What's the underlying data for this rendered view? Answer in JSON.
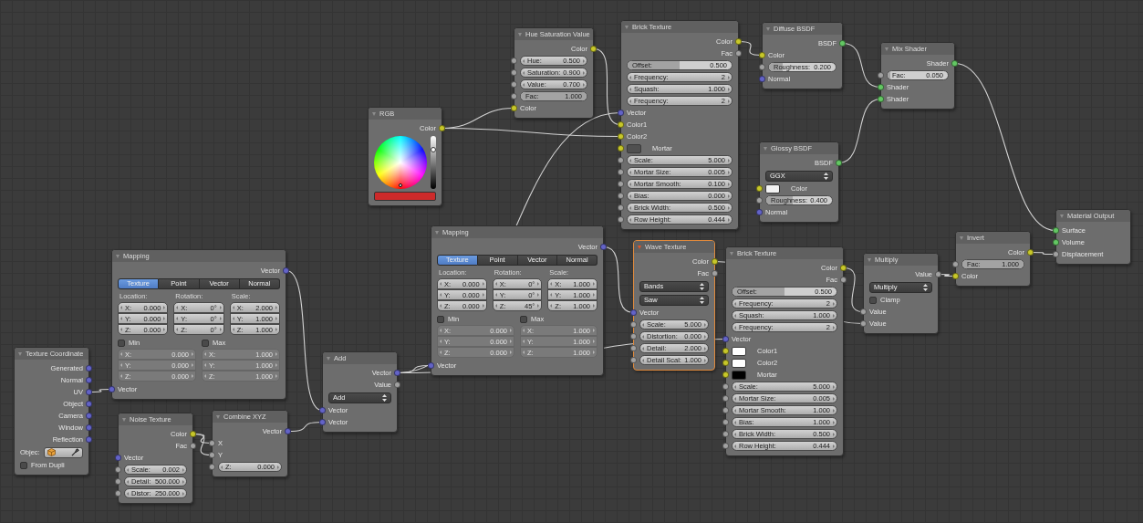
{
  "nodes": [
    {
      "title": "Texture Coordinate",
      "selected": false,
      "rows": [
        {
          "kind": "out",
          "label": "Generated",
          "socket": {
            "color": "#6363c7"
          }
        },
        {
          "kind": "out",
          "label": "Normal",
          "socket": {
            "color": "#6363c7"
          }
        },
        {
          "kind": "out",
          "label": "UV",
          "socket": {
            "color": "#6363c7"
          }
        },
        {
          "kind": "out",
          "label": "Object",
          "socket": {
            "color": "#6363c7"
          }
        },
        {
          "kind": "out",
          "label": "Camera",
          "socket": {
            "color": "#6363c7"
          }
        },
        {
          "kind": "out",
          "label": "Window",
          "socket": {
            "color": "#6363c7"
          }
        },
        {
          "kind": "out",
          "label": "Reflection",
          "socket": {
            "color": "#6363c7"
          }
        },
        {
          "kind": "object",
          "label": "Objec:"
        },
        {
          "kind": "checkbox",
          "label": "From Dupli",
          "checked": false
        }
      ]
    },
    {
      "title": "Mapping",
      "selected": false,
      "rows": [
        {
          "kind": "out",
          "label": "Vector",
          "socket": {
            "color": "#6363c7"
          }
        },
        {
          "kind": "tabs",
          "tabs": [
            {
              "label": "Texture",
              "selected": true
            },
            {
              "label": "Point",
              "selected": false
            },
            {
              "label": "Vector",
              "selected": false
            },
            {
              "label": "Normal",
              "selected": false
            }
          ]
        },
        {
          "kind": "vecgrid",
          "disabled": false,
          "columns": [
            {
              "label": "Location:",
              "fields": [
                {
                  "label": "X:",
                  "value": "0.000"
                },
                {
                  "label": "Y:",
                  "value": "0.000"
                },
                {
                  "label": "Z:",
                  "value": "0.000"
                }
              ]
            },
            {
              "label": "Rotation:",
              "fields": [
                {
                  "label": "X:",
                  "value": "0°"
                },
                {
                  "label": "Y:",
                  "value": "0°"
                },
                {
                  "label": "Z:",
                  "value": "0°"
                }
              ]
            },
            {
              "label": "Scale:",
              "fields": [
                {
                  "label": "X:",
                  "value": "2.000"
                },
                {
                  "label": "Y:",
                  "value": "1.000"
                },
                {
                  "label": "Z:",
                  "value": "1.000"
                }
              ]
            }
          ]
        },
        {
          "kind": "vecgrid",
          "disabled": true,
          "columns": [
            {
              "label": "Min",
              "checked": false,
              "fields": [
                {
                  "label": "X:",
                  "value": "0.000"
                },
                {
                  "label": "Y:",
                  "value": "0.000"
                },
                {
                  "label": "Z:",
                  "value": "0.000"
                }
              ]
            },
            {
              "label": "Max",
              "checked": false,
              "fields": [
                {
                  "label": "X:",
                  "value": "1.000"
                },
                {
                  "label": "Y:",
                  "value": "1.000"
                },
                {
                  "label": "Z:",
                  "value": "1.000"
                }
              ]
            }
          ]
        },
        {
          "kind": "in",
          "label": "Vector",
          "socket": {
            "color": "#6363c7"
          }
        }
      ]
    },
    {
      "title": "Noise Texture",
      "selected": false,
      "rows": [
        {
          "kind": "out",
          "label": "Color",
          "socket": {
            "color": "#c7c729"
          }
        },
        {
          "kind": "out",
          "label": "Fac",
          "socket": {
            "color": "#a1a1a1"
          }
        },
        {
          "kind": "in",
          "label": "Vector",
          "socket": {
            "color": "#6363c7"
          }
        },
        {
          "kind": "number",
          "label": "Scale:",
          "value": "0.002",
          "socket": {
            "color": "#a1a1a1"
          }
        },
        {
          "kind": "number",
          "label": "Detail:",
          "value": "500.000",
          "socket": {
            "color": "#a1a1a1"
          }
        },
        {
          "kind": "number",
          "label": "Distor:",
          "value": "250.000",
          "socket": {
            "color": "#a1a1a1"
          }
        }
      ]
    },
    {
      "title": "Combine XYZ",
      "selected": false,
      "rows": [
        {
          "kind": "out",
          "label": "Vector",
          "socket": {
            "color": "#6363c7"
          }
        },
        {
          "kind": "in",
          "label": "X",
          "socket": {
            "color": "#a1a1a1"
          }
        },
        {
          "kind": "in",
          "label": "Y",
          "socket": {
            "color": "#a1a1a1"
          }
        },
        {
          "kind": "number",
          "label": "Z:",
          "value": "0.000",
          "socket": {
            "color": "#a1a1a1"
          }
        }
      ]
    },
    {
      "title": "Add",
      "selected": false,
      "rows": [
        {
          "kind": "out",
          "label": "Vector",
          "socket": {
            "color": "#6363c7"
          }
        },
        {
          "kind": "out",
          "label": "Value",
          "socket": {
            "color": "#a1a1a1"
          }
        },
        {
          "kind": "dropdown",
          "value": "Add"
        },
        {
          "kind": "in",
          "label": "Vector",
          "socket": {
            "color": "#6363c7"
          }
        },
        {
          "kind": "in",
          "label": "Vector",
          "socket": {
            "color": "#6363c7"
          }
        }
      ]
    },
    {
      "title": "Mapping",
      "selected": false,
      "rows": [
        {
          "kind": "out",
          "label": "Vector",
          "socket": {
            "color": "#6363c7"
          }
        },
        {
          "kind": "tabs",
          "tabs": [
            {
              "label": "Texture",
              "selected": true
            },
            {
              "label": "Point",
              "selected": false
            },
            {
              "label": "Vector",
              "selected": false
            },
            {
              "label": "Normal",
              "selected": false
            }
          ]
        },
        {
          "kind": "vecgrid",
          "disabled": false,
          "columns": [
            {
              "label": "Location:",
              "fields": [
                {
                  "label": "X:",
                  "value": "0.000"
                },
                {
                  "label": "Y:",
                  "value": "0.000"
                },
                {
                  "label": "Z:",
                  "value": "0.000"
                }
              ]
            },
            {
              "label": "Rotation:",
              "fields": [
                {
                  "label": "X:",
                  "value": "0°"
                },
                {
                  "label": "Y:",
                  "value": "0°"
                },
                {
                  "label": "Z:",
                  "value": "45°"
                }
              ]
            },
            {
              "label": "Scale:",
              "fields": [
                {
                  "label": "X:",
                  "value": "1.000"
                },
                {
                  "label": "Y:",
                  "value": "1.000"
                },
                {
                  "label": "Z:",
                  "value": "1.000"
                }
              ]
            }
          ]
        },
        {
          "kind": "vecgrid",
          "disabled": true,
          "columns": [
            {
              "label": "Min",
              "checked": false,
              "fields": [
                {
                  "label": "X:",
                  "value": "0.000"
                },
                {
                  "label": "Y:",
                  "value": "0.000"
                },
                {
                  "label": "Z:",
                  "value": "0.000"
                }
              ]
            },
            {
              "label": "Max",
              "checked": false,
              "fields": [
                {
                  "label": "X:",
                  "value": "1.000"
                },
                {
                  "label": "Y:",
                  "value": "1.000"
                },
                {
                  "label": "Z:",
                  "value": "1.000"
                }
              ]
            }
          ]
        },
        {
          "kind": "in",
          "label": "Vector",
          "socket": {
            "color": "#6363c7"
          }
        }
      ]
    },
    {
      "title": "RGB",
      "selected": false,
      "rows": [
        {
          "kind": "out",
          "label": "Color",
          "socket": {
            "color": "#c7c729"
          }
        },
        {
          "kind": "wheel",
          "color": "#cc2a2a"
        }
      ]
    },
    {
      "title": "Hue Saturation Value",
      "selected": false,
      "rows": [
        {
          "kind": "out",
          "label": "Color",
          "socket": {
            "color": "#c7c729"
          }
        },
        {
          "kind": "number",
          "label": "Hue:",
          "value": "0.500",
          "socket": {
            "color": "#a1a1a1"
          }
        },
        {
          "kind": "number",
          "label": "Saturation:",
          "value": "0.900",
          "socket": {
            "color": "#a1a1a1"
          }
        },
        {
          "kind": "number",
          "label": "Value:",
          "value": "0.700",
          "socket": {
            "color": "#a1a1a1"
          }
        },
        {
          "kind": "slider",
          "label": "Fac:",
          "value": "1.000",
          "level": 1,
          "socket": {
            "color": "#a1a1a1"
          }
        },
        {
          "kind": "in",
          "label": "Color",
          "socket": {
            "color": "#c7c729"
          }
        }
      ]
    },
    {
      "title": "Brick Texture",
      "selected": false,
      "rows": [
        {
          "kind": "out",
          "label": "Color",
          "socket": {
            "color": "#c7c729"
          }
        },
        {
          "kind": "out",
          "label": "Fac",
          "socket": {
            "color": "#a1a1a1"
          }
        },
        {
          "kind": "slider",
          "label": "Offset:",
          "value": "0.500",
          "level": 0.5
        },
        {
          "kind": "number",
          "label": "Frequency:",
          "value": "2"
        },
        {
          "kind": "number",
          "label": "Squash:",
          "value": "1.000"
        },
        {
          "kind": "number",
          "label": "Frequency:",
          "value": "2"
        },
        {
          "kind": "in",
          "label": "Vector",
          "socket": {
            "color": "#6363c7"
          }
        },
        {
          "kind": "in",
          "label": "Color1",
          "socket": {
            "color": "#c7c729"
          }
        },
        {
          "kind": "in",
          "label": "Color2",
          "socket": {
            "color": "#c7c729"
          }
        },
        {
          "kind": "swatch",
          "label": "Mortar",
          "color": "#505050",
          "socket": {
            "color": "#c7c729"
          }
        },
        {
          "kind": "number",
          "label": "Scale:",
          "value": "5.000",
          "socket": {
            "color": "#a1a1a1"
          }
        },
        {
          "kind": "number",
          "label": "Mortar Size:",
          "value": "0.005",
          "socket": {
            "color": "#a1a1a1"
          }
        },
        {
          "kind": "number",
          "label": "Mortar Smooth:",
          "value": "0.100",
          "socket": {
            "color": "#a1a1a1"
          }
        },
        {
          "kind": "number",
          "label": "Bias:",
          "value": "0.000",
          "socket": {
            "color": "#a1a1a1"
          }
        },
        {
          "kind": "number",
          "label": "Brick Width:",
          "value": "0.500",
          "socket": {
            "color": "#a1a1a1"
          }
        },
        {
          "kind": "number",
          "label": "Row Height:",
          "value": "0.444",
          "socket": {
            "color": "#a1a1a1"
          }
        }
      ]
    },
    {
      "title": "Diffuse BSDF",
      "selected": false,
      "rows": [
        {
          "kind": "out",
          "label": "BSDF",
          "socket": {
            "color": "#63c763"
          }
        },
        {
          "kind": "in",
          "label": "Color",
          "socket": {
            "color": "#c7c729"
          }
        },
        {
          "kind": "slider",
          "label": "Roughness:",
          "value": "0.200",
          "level": 0.2,
          "socket": {
            "color": "#a1a1a1"
          }
        },
        {
          "kind": "in",
          "label": "Normal",
          "socket": {
            "color": "#6363c7"
          }
        }
      ]
    },
    {
      "title": "Glossy BSDF",
      "selected": false,
      "rows": [
        {
          "kind": "out",
          "label": "BSDF",
          "socket": {
            "color": "#63c763"
          }
        },
        {
          "kind": "dropdown",
          "value": "GGX"
        },
        {
          "kind": "swatch",
          "label": "Color",
          "color": "#f2f2f2",
          "socket": {
            "color": "#c7c729"
          }
        },
        {
          "kind": "slider",
          "label": "Roughness:",
          "value": "0.400",
          "level": 0.4,
          "socket": {
            "color": "#a1a1a1"
          }
        },
        {
          "kind": "in",
          "label": "Normal",
          "socket": {
            "color": "#6363c7"
          }
        }
      ]
    },
    {
      "title": "Mix Shader",
      "selected": false,
      "rows": [
        {
          "kind": "out",
          "label": "Shader",
          "socket": {
            "color": "#63c763"
          }
        },
        {
          "kind": "slider",
          "label": "Fac:",
          "value": "0.050",
          "level": 0.05,
          "socket": {
            "color": "#a1a1a1"
          }
        },
        {
          "kind": "in",
          "label": "Shader",
          "socket": {
            "color": "#63c763"
          }
        },
        {
          "kind": "in",
          "label": "Shader",
          "socket": {
            "color": "#63c763"
          }
        }
      ]
    },
    {
      "title": "Wave Texture",
      "selected": true,
      "rows": [
        {
          "kind": "out",
          "label": "Color",
          "socket": {
            "color": "#c7c729"
          }
        },
        {
          "kind": "out",
          "label": "Fac",
          "socket": {
            "color": "#a1a1a1"
          }
        },
        {
          "kind": "dropdown",
          "value": "Bands"
        },
        {
          "kind": "dropdown",
          "value": "Saw"
        },
        {
          "kind": "in",
          "label": "Vector",
          "socket": {
            "color": "#6363c7"
          }
        },
        {
          "kind": "number",
          "label": "Scale:",
          "value": "5.000",
          "socket": {
            "color": "#a1a1a1"
          }
        },
        {
          "kind": "number",
          "label": "Distortion:",
          "value": "0.000",
          "socket": {
            "color": "#a1a1a1"
          }
        },
        {
          "kind": "number",
          "label": "Detail:",
          "value": "2.000",
          "socket": {
            "color": "#a1a1a1"
          }
        },
        {
          "kind": "number",
          "label": "Detail Scal:",
          "value": "1.000",
          "socket": {
            "color": "#a1a1a1"
          }
        }
      ]
    },
    {
      "title": "Brick Texture",
      "selected": false,
      "rows": [
        {
          "kind": "out",
          "label": "Color",
          "socket": {
            "color": "#c7c729"
          }
        },
        {
          "kind": "out",
          "label": "Fac",
          "socket": {
            "color": "#a1a1a1"
          }
        },
        {
          "kind": "slider",
          "label": "Offset:",
          "value": "0.500",
          "level": 0.5
        },
        {
          "kind": "number",
          "label": "Frequency:",
          "value": "2"
        },
        {
          "kind": "number",
          "label": "Squash:",
          "value": "1.000"
        },
        {
          "kind": "number",
          "label": "Frequency:",
          "value": "2"
        },
        {
          "kind": "in",
          "label": "Vector",
          "socket": {
            "color": "#6363c7"
          }
        },
        {
          "kind": "swatch",
          "label": "Color1",
          "color": "#ffffff",
          "socket": {
            "color": "#c7c729"
          }
        },
        {
          "kind": "swatch",
          "label": "Color2",
          "color": "#ffffff",
          "socket": {
            "color": "#c7c729"
          }
        },
        {
          "kind": "swatch",
          "label": "Mortar",
          "color": "#000000",
          "socket": {
            "color": "#c7c729"
          }
        },
        {
          "kind": "number",
          "label": "Scale:",
          "value": "5.000",
          "socket": {
            "color": "#a1a1a1"
          }
        },
        {
          "kind": "number",
          "label": "Mortar Size:",
          "value": "0.005",
          "socket": {
            "color": "#a1a1a1"
          }
        },
        {
          "kind": "number",
          "label": "Mortar Smooth:",
          "value": "1.000",
          "socket": {
            "color": "#a1a1a1"
          }
        },
        {
          "kind": "number",
          "label": "Bias:",
          "value": "1.000",
          "socket": {
            "color": "#a1a1a1"
          }
        },
        {
          "kind": "number",
          "label": "Brick Width:",
          "value": "0.500",
          "socket": {
            "color": "#a1a1a1"
          }
        },
        {
          "kind": "number",
          "label": "Row Height:",
          "value": "0.444",
          "socket": {
            "color": "#a1a1a1"
          }
        }
      ]
    },
    {
      "title": "Multiply",
      "selected": false,
      "rows": [
        {
          "kind": "out",
          "label": "Value",
          "socket": {
            "color": "#a1a1a1"
          }
        },
        {
          "kind": "dropdown",
          "value": "Multiply"
        },
        {
          "kind": "checkbox",
          "label": "Clamp",
          "checked": false
        },
        {
          "kind": "in",
          "label": "Value",
          "socket": {
            "color": "#a1a1a1"
          }
        },
        {
          "kind": "in",
          "label": "Value",
          "socket": {
            "color": "#a1a1a1"
          }
        }
      ]
    },
    {
      "title": "Invert",
      "selected": false,
      "rows": [
        {
          "kind": "out",
          "label": "Color",
          "socket": {
            "color": "#c7c729"
          }
        },
        {
          "kind": "slider",
          "label": "Fac:",
          "value": "1.000",
          "level": 1,
          "socket": {
            "color": "#a1a1a1"
          }
        },
        {
          "kind": "in",
          "label": "Color",
          "socket": {
            "color": "#c7c729"
          }
        }
      ]
    },
    {
      "title": "Material Output",
      "selected": false,
      "rows": [
        {
          "kind": "in",
          "label": "Surface",
          "socket": {
            "color": "#63c763"
          }
        },
        {
          "kind": "in",
          "label": "Volume",
          "socket": {
            "color": "#63c763"
          }
        },
        {
          "kind": "in",
          "label": "Displacement",
          "socket": {
            "color": "#a1a1a1"
          }
        }
      ]
    }
  ]
}
